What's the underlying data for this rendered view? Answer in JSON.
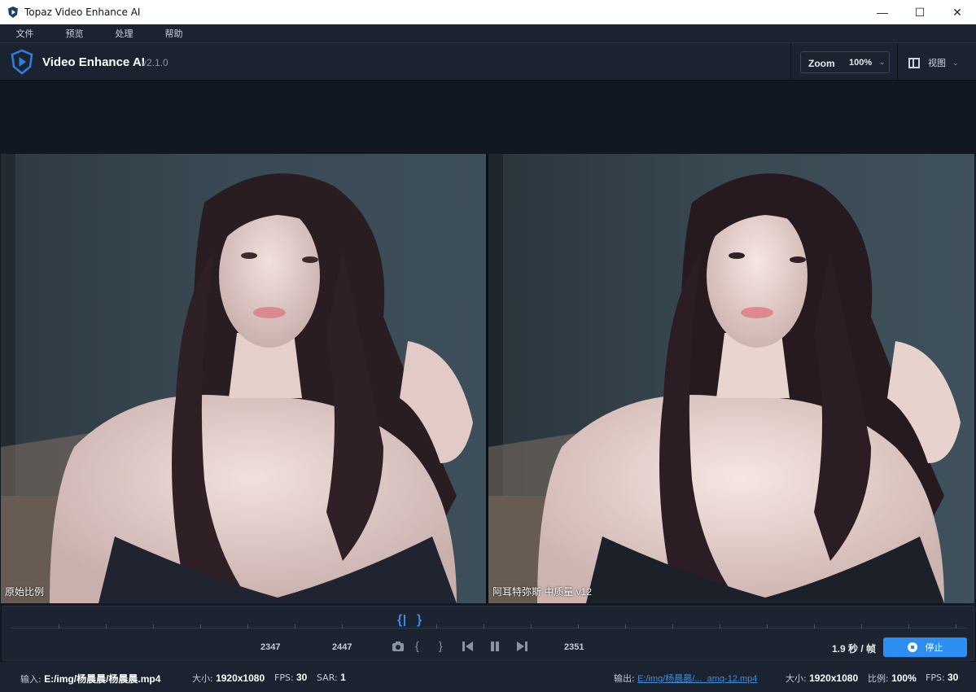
{
  "window": {
    "title": "Topaz Video Enhance AI",
    "minimize": "—",
    "maximize": "☐",
    "close": "✕"
  },
  "menu": [
    "文件",
    "预览",
    "处理",
    "帮助"
  ],
  "header": {
    "app_name": "Video Enhance AI",
    "version": "v2.1.0",
    "zoom_label": "Zoom",
    "zoom_value": "100%",
    "view_label": "视图"
  },
  "preview": {
    "left_caption": "原始比例",
    "right_caption": "阿耳特弥斯 中质量 v12"
  },
  "timeline": {
    "frame_start": "2347",
    "frame_end": "2447",
    "frame_current": "2351",
    "speed": "1.9 秒 / 帧",
    "stop_label": "停止"
  },
  "status": {
    "input_label": "输入:",
    "input_path": "E:/img/杨晨晨/杨晨晨.mp4",
    "input_size_label": "大小:",
    "input_size": "1920x1080",
    "fps_label": "FPS:",
    "fps": "30",
    "sar_label": "SAR:",
    "sar": "1",
    "output_label": "输出:",
    "output_path": "E:/img/杨晨晨/..._amq-12.mp4",
    "output_size_label": "大小:",
    "output_size": "1920x1080",
    "ratio_label": "比例:",
    "ratio": "100%",
    "out_fps_label": "FPS:",
    "out_fps": "30"
  },
  "colors": {
    "accent": "#2b8ef0",
    "background": "#141a24",
    "panel": "#1b2330"
  }
}
